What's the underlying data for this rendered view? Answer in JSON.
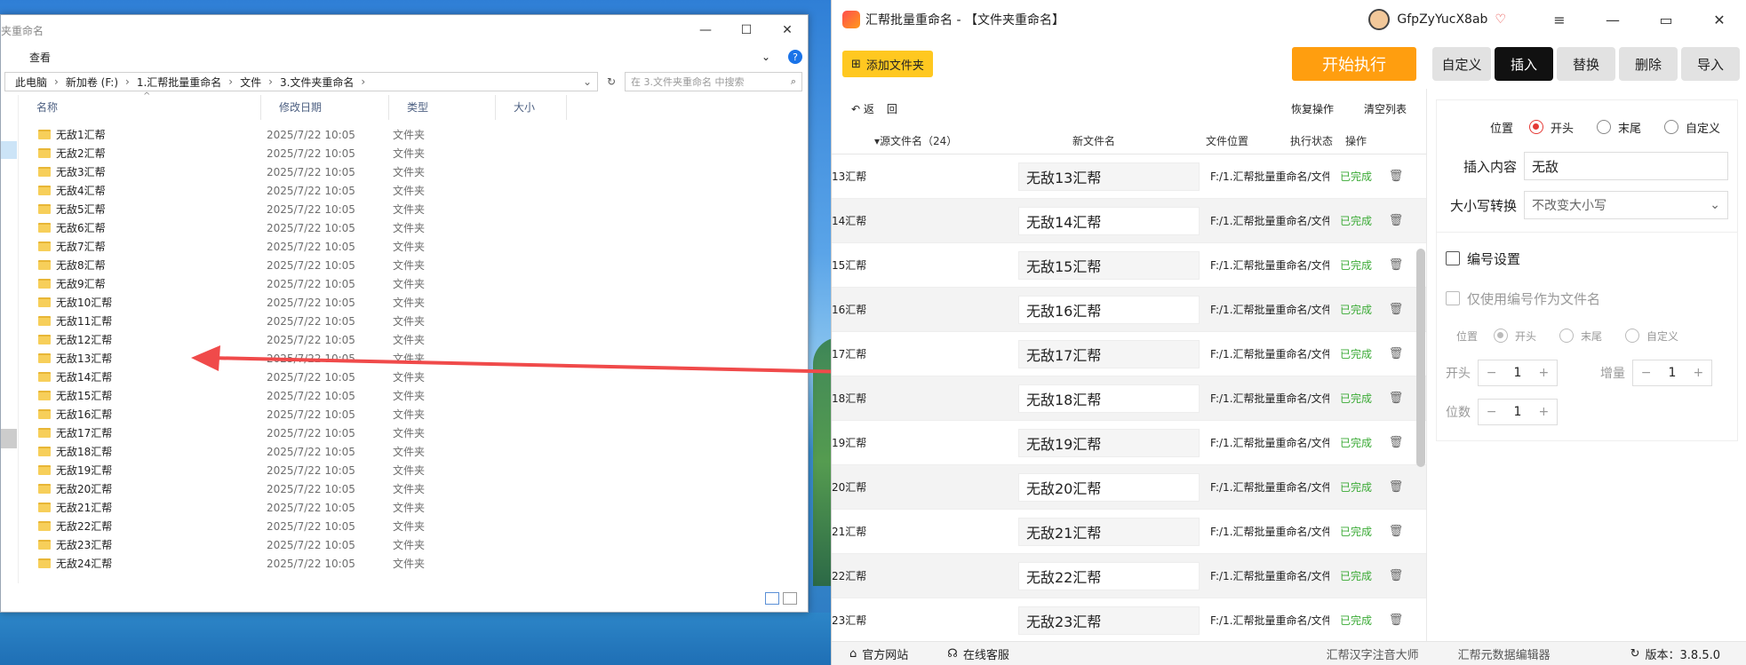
{
  "explorer": {
    "title": "夹重命名",
    "menu_view": "查看",
    "breadcrumb": [
      "此电脑",
      "新加卷 (F:)",
      "1.汇帮批量重命名",
      "文件",
      "3.文件夹重命名"
    ],
    "search_placeholder": "在 3.文件夹重命名 中搜索",
    "columns": {
      "name": "名称",
      "date": "修改日期",
      "type": "类型",
      "size": "大小"
    },
    "files": [
      {
        "name": "无敌1汇帮",
        "date": "2025/7/22 10:05",
        "type": "文件夹"
      },
      {
        "name": "无敌2汇帮",
        "date": "2025/7/22 10:05",
        "type": "文件夹"
      },
      {
        "name": "无敌3汇帮",
        "date": "2025/7/22 10:05",
        "type": "文件夹"
      },
      {
        "name": "无敌4汇帮",
        "date": "2025/7/22 10:05",
        "type": "文件夹"
      },
      {
        "name": "无敌5汇帮",
        "date": "2025/7/22 10:05",
        "type": "文件夹"
      },
      {
        "name": "无敌6汇帮",
        "date": "2025/7/22 10:05",
        "type": "文件夹"
      },
      {
        "name": "无敌7汇帮",
        "date": "2025/7/22 10:05",
        "type": "文件夹"
      },
      {
        "name": "无敌8汇帮",
        "date": "2025/7/22 10:05",
        "type": "文件夹"
      },
      {
        "name": "无敌9汇帮",
        "date": "2025/7/22 10:05",
        "type": "文件夹"
      },
      {
        "name": "无敌10汇帮",
        "date": "2025/7/22 10:05",
        "type": "文件夹"
      },
      {
        "name": "无敌11汇帮",
        "date": "2025/7/22 10:05",
        "type": "文件夹"
      },
      {
        "name": "无敌12汇帮",
        "date": "2025/7/22 10:05",
        "type": "文件夹"
      },
      {
        "name": "无敌13汇帮",
        "date": "2025/7/22 10:05",
        "type": "文件夹"
      },
      {
        "name": "无敌14汇帮",
        "date": "2025/7/22 10:05",
        "type": "文件夹"
      },
      {
        "name": "无敌15汇帮",
        "date": "2025/7/22 10:05",
        "type": "文件夹"
      },
      {
        "name": "无敌16汇帮",
        "date": "2025/7/22 10:05",
        "type": "文件夹"
      },
      {
        "name": "无敌17汇帮",
        "date": "2025/7/22 10:05",
        "type": "文件夹"
      },
      {
        "name": "无敌18汇帮",
        "date": "2025/7/22 10:05",
        "type": "文件夹"
      },
      {
        "name": "无敌19汇帮",
        "date": "2025/7/22 10:05",
        "type": "文件夹"
      },
      {
        "name": "无敌20汇帮",
        "date": "2025/7/22 10:05",
        "type": "文件夹"
      },
      {
        "name": "无敌21汇帮",
        "date": "2025/7/22 10:05",
        "type": "文件夹"
      },
      {
        "name": "无敌22汇帮",
        "date": "2025/7/22 10:05",
        "type": "文件夹"
      },
      {
        "name": "无敌23汇帮",
        "date": "2025/7/22 10:05",
        "type": "文件夹"
      },
      {
        "name": "无敌24汇帮",
        "date": "2025/7/22 10:05",
        "type": "文件夹"
      }
    ]
  },
  "app": {
    "title": "汇帮批量重命名 - 【文件夹重命名】",
    "username": "GfpZyYucX8ab",
    "add_folder": "添加文件夹",
    "start": "开始执行",
    "tabs": [
      "自定义",
      "插入",
      "替换",
      "删除",
      "导入"
    ],
    "active_tab": "插入",
    "back": "返",
    "back2": "回",
    "restore": "恢复操作",
    "clear": "清空列表",
    "headers": {
      "src": "源文件名（24）",
      "new": "新文件名",
      "loc": "文件位置",
      "status": "执行状态",
      "op": "操作"
    },
    "rows": [
      {
        "src": "13汇帮",
        "new": "无敌13汇帮",
        "loc": "F:/1.汇帮批量重命名/文件",
        "status": "已完成"
      },
      {
        "src": "14汇帮",
        "new": "无敌14汇帮",
        "loc": "F:/1.汇帮批量重命名/文件",
        "status": "已完成"
      },
      {
        "src": "15汇帮",
        "new": "无敌15汇帮",
        "loc": "F:/1.汇帮批量重命名/文件",
        "status": "已完成"
      },
      {
        "src": "16汇帮",
        "new": "无敌16汇帮",
        "loc": "F:/1.汇帮批量重命名/文件",
        "status": "已完成"
      },
      {
        "src": "17汇帮",
        "new": "无敌17汇帮",
        "loc": "F:/1.汇帮批量重命名/文件",
        "status": "已完成"
      },
      {
        "src": "18汇帮",
        "new": "无敌18汇帮",
        "loc": "F:/1.汇帮批量重命名/文件",
        "status": "已完成"
      },
      {
        "src": "19汇帮",
        "new": "无敌19汇帮",
        "loc": "F:/1.汇帮批量重命名/文件",
        "status": "已完成"
      },
      {
        "src": "20汇帮",
        "new": "无敌20汇帮",
        "loc": "F:/1.汇帮批量重命名/文件",
        "status": "已完成"
      },
      {
        "src": "21汇帮",
        "new": "无敌21汇帮",
        "loc": "F:/1.汇帮批量重命名/文件",
        "status": "已完成"
      },
      {
        "src": "22汇帮",
        "new": "无敌22汇帮",
        "loc": "F:/1.汇帮批量重命名/文件",
        "status": "已完成"
      },
      {
        "src": "23汇帮",
        "new": "无敌23汇帮",
        "loc": "F:/1.汇帮批量重命名/文件",
        "status": "已完成"
      }
    ],
    "panel": {
      "position_label": "位置",
      "pos_options": [
        "开头",
        "末尾",
        "自定义"
      ],
      "insert_label": "插入内容",
      "insert_value": "无敌",
      "case_label": "大小写转换",
      "case_value": "不改变大小写",
      "numbering": "编号设置",
      "only_number": "仅使用编号作为文件名",
      "num_position_label": "位置",
      "start_label": "开头",
      "start_value": "1",
      "step_label": "增量",
      "step_value": "1",
      "digits_label": "位数",
      "digits_value": "1"
    },
    "footer": {
      "website": "官方网站",
      "service": "在线客服",
      "app1": "汇帮汉字注音大师",
      "app2": "汇帮元数据编辑器",
      "version": "版本：3.8.5.0"
    },
    "colors": {
      "accent": "#ffc820",
      "start": "#ff9e0f",
      "done": "#3aaa35",
      "radio": "#e53935"
    }
  }
}
